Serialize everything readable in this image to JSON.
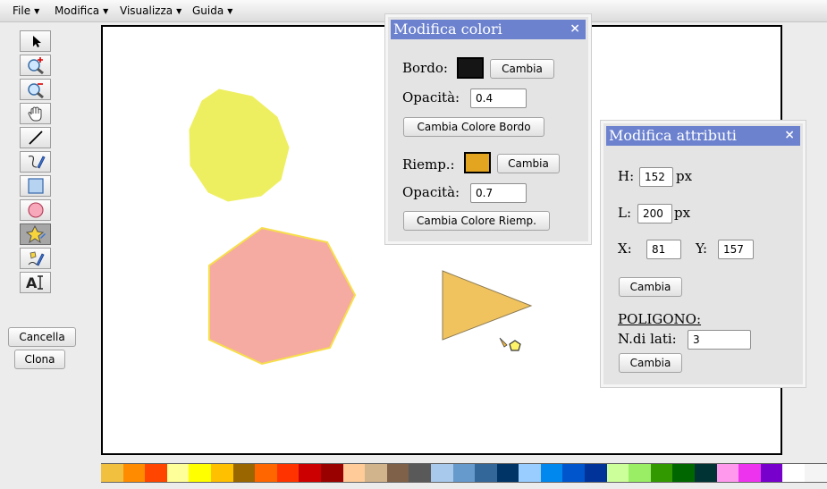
{
  "menubar": {
    "items": [
      {
        "label": "File"
      },
      {
        "label": "Modifica"
      },
      {
        "label": "Visualizza"
      },
      {
        "label": "Guida"
      }
    ]
  },
  "toolbar": {
    "tools": [
      {
        "icon": "pointer-icon"
      },
      {
        "icon": "zoom-in-icon"
      },
      {
        "icon": "zoom-out-icon"
      },
      {
        "icon": "pan-hand-icon"
      },
      {
        "icon": "line-icon"
      },
      {
        "icon": "freehand-pen-icon"
      },
      {
        "icon": "rectangle-icon"
      },
      {
        "icon": "ellipse-icon"
      },
      {
        "icon": "polygon-star-icon",
        "selected": true
      },
      {
        "icon": "polygon-pen-icon"
      },
      {
        "icon": "text-icon"
      }
    ]
  },
  "side_buttons": {
    "delete_label": "Cancella",
    "clone_label": "Clona"
  },
  "canvas": {
    "shapes": [
      {
        "type": "nonagon",
        "fill": "#eeef60",
        "stroke": "#eeef60"
      },
      {
        "type": "heptagon",
        "fill": "#f5aaa2",
        "stroke": "#f7de4c"
      },
      {
        "type": "triangle",
        "fill": "#f1c35f",
        "stroke": "#8b7a52"
      }
    ]
  },
  "color_panel": {
    "title": "Modifica colori",
    "close": "×",
    "border_label": "Bordo:",
    "border_color": "#151515",
    "border_apply": "Cambia",
    "border_opacity_label": "Opacità:",
    "border_opacity": "0.4",
    "border_change_button": "Cambia Colore Bordo",
    "fill_label": "Riemp.:",
    "fill_color": "#e3a41f",
    "fill_apply": "Cambia",
    "fill_opacity_label": "Opacità:",
    "fill_opacity": "0.7",
    "fill_change_button": "Cambia Colore Riemp."
  },
  "attr_panel": {
    "title": "Modifica attributi",
    "close": "×",
    "h_label": "H:",
    "h_value": "152",
    "h_unit": "px",
    "w_label": "L:",
    "w_value": "200",
    "w_unit": "px",
    "x_label": "X:",
    "x_value": "81",
    "y_label": "Y:",
    "y_value": "157",
    "apply_button": "Cambia",
    "section_label": "POLIGONO:",
    "sides_label": "N.di lati:",
    "sides_value": "3",
    "sides_apply": "Cambia"
  },
  "palette": {
    "colors": [
      "#f1c03e",
      "#ff8c00",
      "#ff4500",
      "#ffff99",
      "#ffff00",
      "#ffc000",
      "#996600",
      "#ff6600",
      "#ff3300",
      "#cc0000",
      "#990000",
      "#ffcc99",
      "#d2b48c",
      "#7f6048",
      "#595959",
      "#a8c8ec",
      "#6699cc",
      "#336699",
      "#003366",
      "#99ccff",
      "#0088ee",
      "#0055cc",
      "#003399",
      "#ccff99",
      "#99ee66",
      "#339900",
      "#006600",
      "#003333",
      "#ff99ee",
      "#ee33ee",
      "#7700cc",
      "#ffffff",
      "#f4f4f4"
    ]
  }
}
